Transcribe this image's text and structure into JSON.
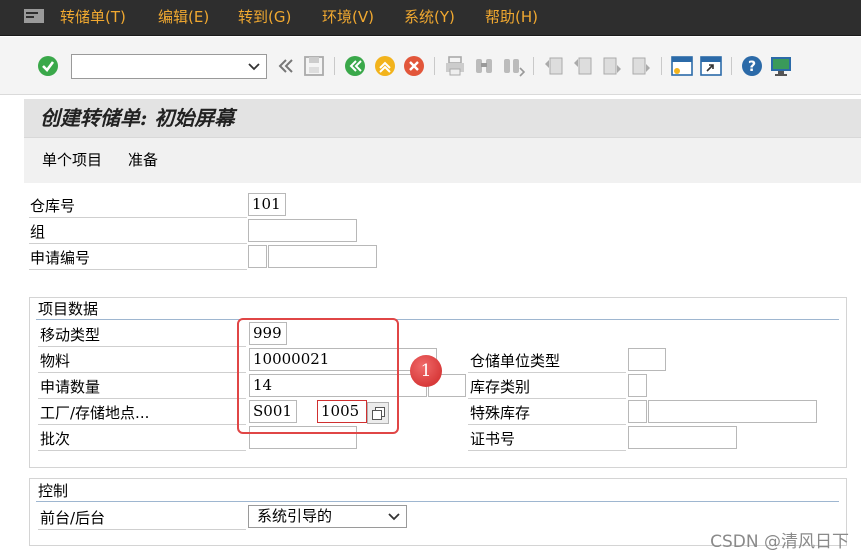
{
  "menu": {
    "items": [
      "转储单(T)",
      "编辑(E)",
      "转到(G)",
      "环境(V)",
      "系统(Y)",
      "帮助(H)"
    ]
  },
  "toolbar": {
    "command_value": "",
    "icons": [
      "enter-icon",
      "command-field",
      "collapse-icon",
      "save-icon",
      "back-icon",
      "exit-icon",
      "cancel-icon",
      "print-icon",
      "find-icon",
      "find-next-icon",
      "first-page-icon",
      "prev-page-icon",
      "next-page-icon",
      "last-page-icon",
      "new-session-icon",
      "shortcut-icon",
      "help-icon",
      "customize-icon"
    ]
  },
  "title": "创建转储单: 初始屏幕",
  "appbar": {
    "single_item": "单个项目",
    "prepare": "准备"
  },
  "header_fields": {
    "warehouse_label": "仓库号",
    "warehouse_value": "101",
    "group_label": "组",
    "group_value": "",
    "request_label": "申请编号",
    "request_value_1": "",
    "request_value_2": ""
  },
  "item_data": {
    "section_title": "项目数据",
    "movement_type_label": "移动类型",
    "movement_type_value": "999",
    "material_label": "物料",
    "material_value": "10000021",
    "quantity_label": "申请数量",
    "quantity_value": "14",
    "quantity_unit": "",
    "plant_sloc_label": "工厂/存储地点...",
    "plant_value": "S001",
    "sloc_value": "1005",
    "batch_label": "批次",
    "batch_value": "",
    "storage_unit_type_label": "仓储单位类型",
    "storage_unit_type_value": "",
    "stock_category_label": "库存类别",
    "stock_category_value": "",
    "special_stock_label": "特殊库存",
    "special_stock_value_1": "",
    "special_stock_value_2": "",
    "certificate_label": "证书号",
    "certificate_value": ""
  },
  "control": {
    "section_title": "控制",
    "foreground_label": "前台/后台",
    "foreground_value": "系统引导的"
  },
  "annotation": {
    "marker_text": "1",
    "highlight_color": "#e04646"
  },
  "watermark": "CSDN @清风日下",
  "colors": {
    "menubar_bg": "#2e2e2e",
    "menu_text": "#f0a830"
  }
}
